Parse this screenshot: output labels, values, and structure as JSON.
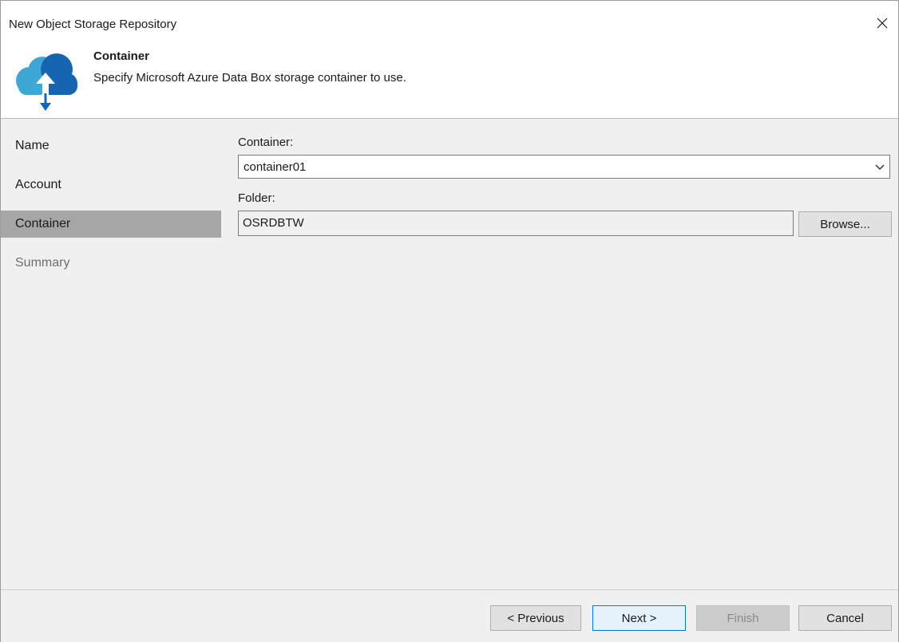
{
  "window": {
    "title": "New Object Storage Repository"
  },
  "header": {
    "title": "Container",
    "subtitle": "Specify Microsoft Azure Data Box storage container to use."
  },
  "nav": {
    "items": [
      {
        "label": "Name",
        "state": "normal"
      },
      {
        "label": "Account",
        "state": "normal"
      },
      {
        "label": "Container",
        "state": "selected"
      },
      {
        "label": "Summary",
        "state": "disabled"
      }
    ]
  },
  "form": {
    "container_label": "Container:",
    "container_value": "container01",
    "folder_label": "Folder:",
    "folder_value": "OSRDBTW",
    "browse_label": "Browse..."
  },
  "footer": {
    "previous_label": "< Previous",
    "next_label": "Next >",
    "finish_label": "Finish",
    "cancel_label": "Cancel"
  },
  "icons": {
    "close": "close-icon",
    "header": "cloud-upload-download-icon",
    "dropdown": "chevron-down-icon"
  },
  "colors": {
    "nav_selected": "#a6a6a6",
    "panel_background": "#f0f0f0",
    "primary_button_border": "#0078d7",
    "cloud_light": "#3fa7d6",
    "cloud_dark": "#1565b0"
  }
}
